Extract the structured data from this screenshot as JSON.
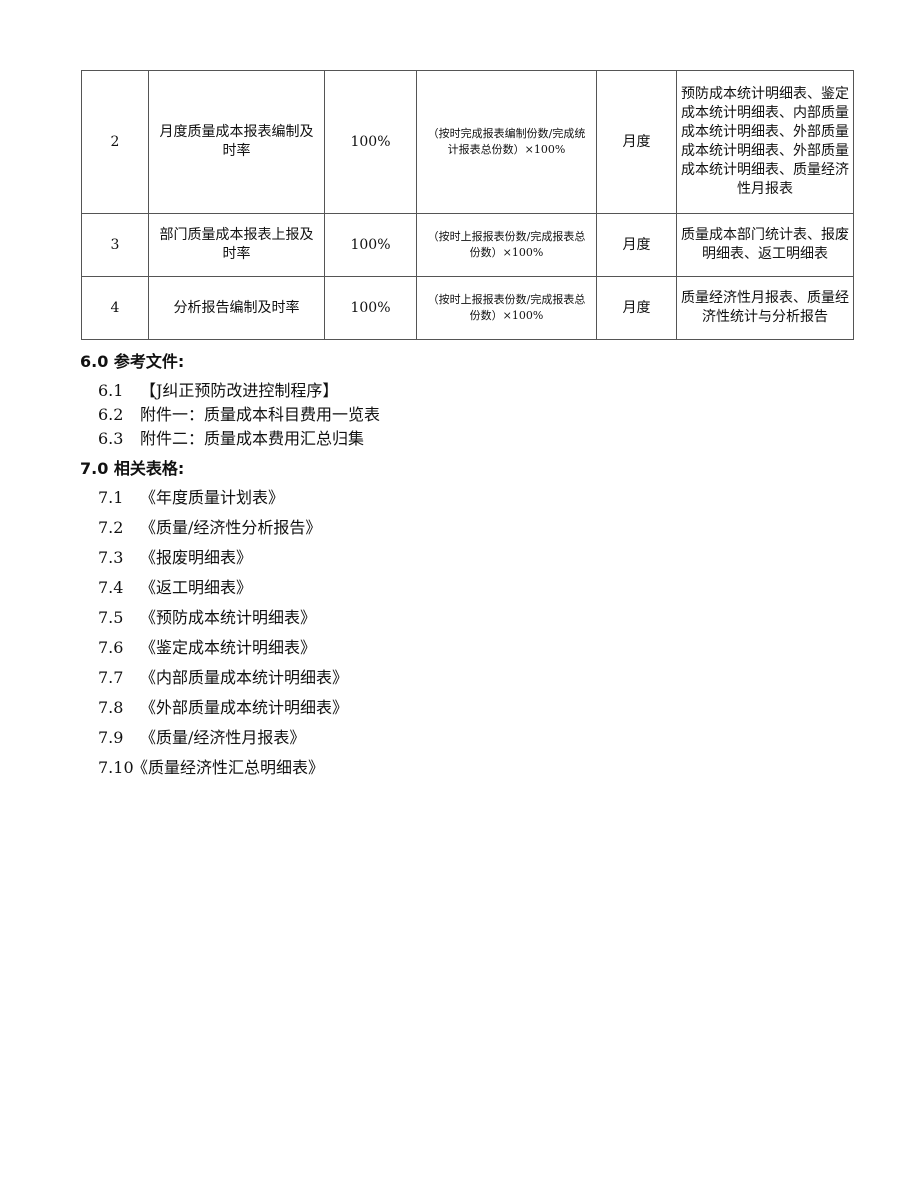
{
  "table": {
    "rows": [
      {
        "no": "2",
        "item": "月度质量成本报表编制及时率",
        "target": "100%",
        "formula": "（按时完成报表编制份数/完成统计报表总份数）×100%",
        "period": "月度",
        "records": "预防成本统计明细表、鉴定成本统计明细表、内部质量成本统计明细表、外部质量成本统计明细表、外部质量成本统计明细表、质量经济性月报表"
      },
      {
        "no": "3",
        "item": "部门质量成本报表上报及时率",
        "target": "100%",
        "formula": "（按时上报报表份数/完成报表总份数）×100%",
        "period": "月度",
        "records": "质量成本部门统计表、报废明细表、返工明细表"
      },
      {
        "no": "4",
        "item": "分析报告编制及时率",
        "target": "100%",
        "formula": "（按时上报报表份数/完成报表总份数）×100%",
        "period": "月度",
        "records": "质量经济性月报表、质量经济性统计与分析报告"
      }
    ]
  },
  "section6": {
    "title": "6.0 参考文件:",
    "items": [
      {
        "num": "6.1",
        "text": "【J纠正预防改进控制程序】"
      },
      {
        "num": "6.2",
        "text": "附件一：质量成本科目费用一览表"
      },
      {
        "num": "6.3",
        "text": "附件二：质量成本费用汇总归集"
      }
    ]
  },
  "section7": {
    "title": "7.0 相关表格:",
    "items": [
      {
        "num": "7.1",
        "text": "《年度质量计划表》"
      },
      {
        "num": "7.2",
        "text": "《质量/经济性分析报告》"
      },
      {
        "num": "7.3",
        "text": "《报废明细表》"
      },
      {
        "num": "7.4",
        "text": "《返工明细表》"
      },
      {
        "num": "7.5",
        "text": "《预防成本统计明细表》"
      },
      {
        "num": "7.6",
        "text": "《鉴定成本统计明细表》"
      },
      {
        "num": "7.7",
        "text": "《内部质量成本统计明细表》"
      },
      {
        "num": "7.8",
        "text": "《外部质量成本统计明细表》"
      },
      {
        "num": "7.9",
        "text": "《质量/经济性月报表》"
      },
      {
        "num": "7.10",
        "text": "《质量经济性汇总明细表》"
      }
    ]
  }
}
